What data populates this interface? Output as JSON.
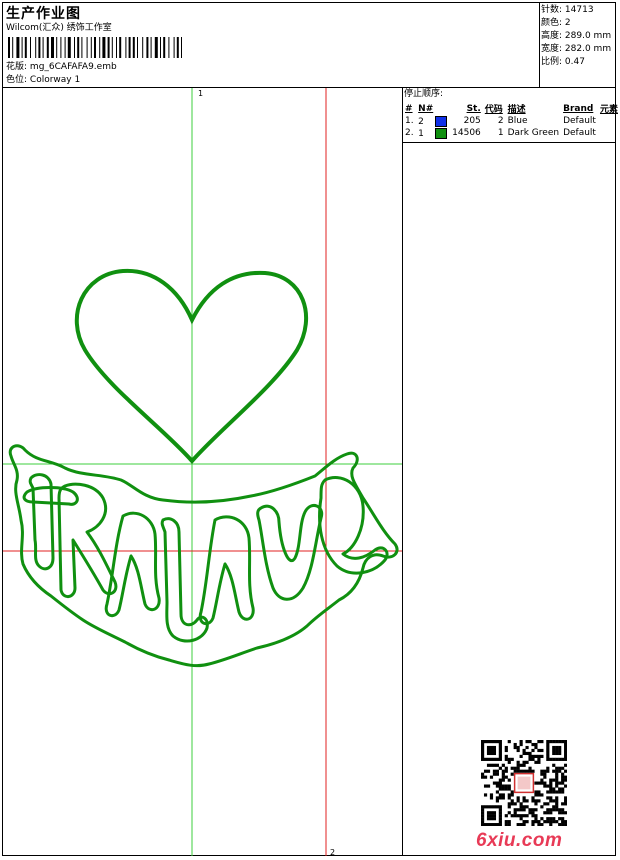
{
  "header": {
    "title": "生产作业图",
    "subtitle": "Wilcom(汇众) 绣饰工作室",
    "design_file_label": "花版:",
    "design_file": "mg_6CAFAFA9.emb",
    "colorway_label": "色位:",
    "colorway": "Colorway 1"
  },
  "stats": {
    "stitches_label": "针数:",
    "stitches": "14713",
    "colors_label": "颜色:",
    "colors": "2",
    "height_label": "高度:",
    "height": "289.0 mm",
    "width_label": "宽度:",
    "width": "282.0 mm",
    "scale_label": "比例:",
    "scale": "0.47"
  },
  "stop_sequence": {
    "title": "停止顺序:",
    "columns": [
      "#",
      "N#",
      "St.",
      "代码",
      "描述",
      "Brand",
      "元素"
    ],
    "rows": [
      {
        "num": "1.",
        "needle": "2",
        "color": "#1030e8",
        "stitches": "205",
        "code": "2",
        "desc": "Blue",
        "brand": "Default"
      },
      {
        "num": "2.",
        "needle": "1",
        "color": "#109010",
        "stitches": "14506",
        "code": "1",
        "desc": "Dark Green",
        "brand": "Default"
      }
    ]
  },
  "markers": {
    "top": "1",
    "bottom": "2"
  },
  "watermark": "6xiu.com",
  "colors": {
    "thread_green": "#109010",
    "guide_green": "#3ccf3c",
    "guide_red": "#e02020"
  }
}
